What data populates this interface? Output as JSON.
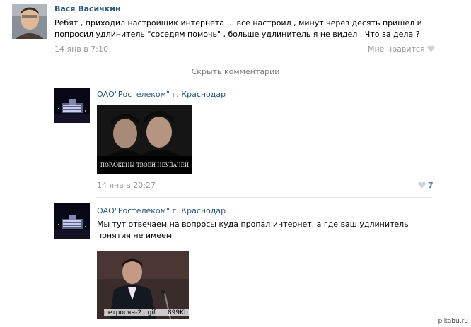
{
  "post": {
    "author": "Вася Васичкин",
    "text": "Ребят , приходил настройщик интернета ... все настроил , минут через десять пришел и попросил удлинитель \"соседям помочь\" , больше удлинитель я не видел . Что за дела ?",
    "date": "14 янв в 7:10",
    "like_label": "Мне нравится"
  },
  "hide_comments_label": "Скрыть комментарии",
  "comments": [
    {
      "author": "ОАО\"Ростелеком\" г. Краснодар",
      "image_caption": "ПОРАЖЕНЫ ТВОЕЙ НЕУДАЧЕЙ",
      "date": "14 янв в 20:27",
      "likes": "7"
    },
    {
      "author": "ОАО\"Ростелеком\" г. Краснодар",
      "text": "Мы тут отвечаем на вопросы куда пропал интернет, а где ваш удлинитель понятия не имеем",
      "file_name": "петросян-2...gif",
      "file_size": "899Kb"
    }
  ],
  "watermark": "pikabu.ru",
  "colors": {
    "link": "#2b587a",
    "meta": "#999999",
    "divider": "#e4e8ed",
    "like_count": "#5f7fa1"
  }
}
